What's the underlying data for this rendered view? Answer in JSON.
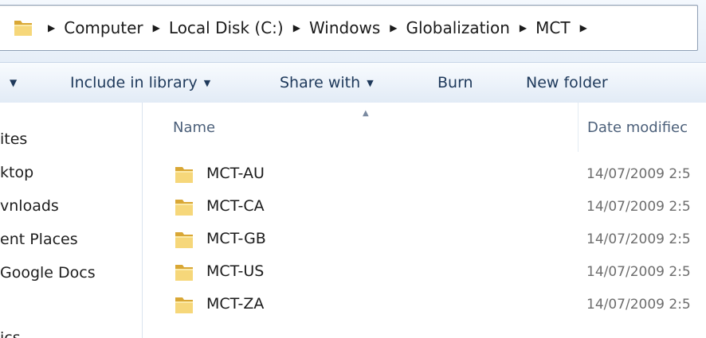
{
  "breadcrumb": {
    "items": [
      "Computer",
      "Local Disk (C:)",
      "Windows",
      "Globalization",
      "MCT"
    ]
  },
  "toolbar": {
    "organize_arrow": "▼",
    "include_in_library": "Include in library",
    "share_with": "Share with",
    "burn": "Burn",
    "new_folder": "New folder"
  },
  "nav": {
    "items": [
      "ites",
      "ktop",
      "vnloads",
      "ent Places",
      "Google Docs",
      "ics"
    ]
  },
  "columns": {
    "name": "Name",
    "date_modified": "Date modifiec"
  },
  "files": [
    {
      "name": "MCT-AU",
      "date": "14/07/2009 2:5"
    },
    {
      "name": "MCT-CA",
      "date": "14/07/2009 2:5"
    },
    {
      "name": "MCT-GB",
      "date": "14/07/2009 2:5"
    },
    {
      "name": "MCT-US",
      "date": "14/07/2009 2:5"
    },
    {
      "name": "MCT-ZA",
      "date": "14/07/2009 2:5"
    }
  ],
  "icons": {
    "folder": "folder-icon",
    "breadcrumb_separator": "chevron-right-icon",
    "dropdown": "chevron-down-icon",
    "sort": "sort-ascending-icon"
  },
  "colors": {
    "folder_light": "#f6d77a",
    "folder_dark": "#d9a735",
    "toolbar_text": "#1e395b",
    "date_text": "#6d6d6d"
  }
}
